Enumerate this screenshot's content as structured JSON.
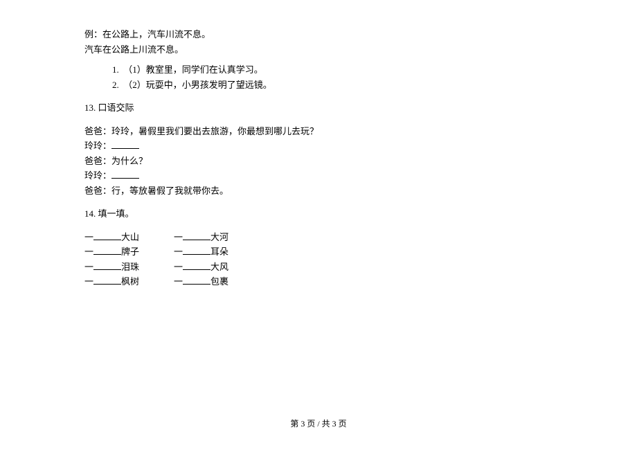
{
  "example": {
    "line1": "例：在公路上，汽车川流不息。",
    "line2": "汽车在公路上川流不息。"
  },
  "subitems": {
    "item1_num": "1.",
    "item1_text": "（1）教室里，同学们在认真学习。",
    "item2_num": "2.",
    "item2_text": "（2）玩耍中，小男孩发明了望远镜。"
  },
  "section13": {
    "title": "13.  口语交际",
    "d1": "爸爸：玲玲，暑假里我们要出去旅游，你最想到哪儿去玩？",
    "d2_prefix": "玲玲：",
    "d3": "爸爸：为什么？",
    "d4_prefix": "玲玲：",
    "d5": "爸爸：行，等放暑假了我就带你去。"
  },
  "section14": {
    "title": "14.  填一填。",
    "rows": [
      {
        "left_prefix": "一",
        "left_suffix": "大山",
        "right_prefix": "一",
        "right_suffix": "大河"
      },
      {
        "left_prefix": "一",
        "left_suffix": "牌子",
        "right_prefix": "一",
        "right_suffix": "耳朵"
      },
      {
        "left_prefix": "一",
        "left_suffix": "泪珠",
        "right_prefix": "一",
        "right_suffix": "大风"
      },
      {
        "left_prefix": "一",
        "left_suffix": "枫树",
        "right_prefix": "一",
        "right_suffix": "包裹"
      }
    ]
  },
  "footer": "第 3 页   /   共 3 页"
}
